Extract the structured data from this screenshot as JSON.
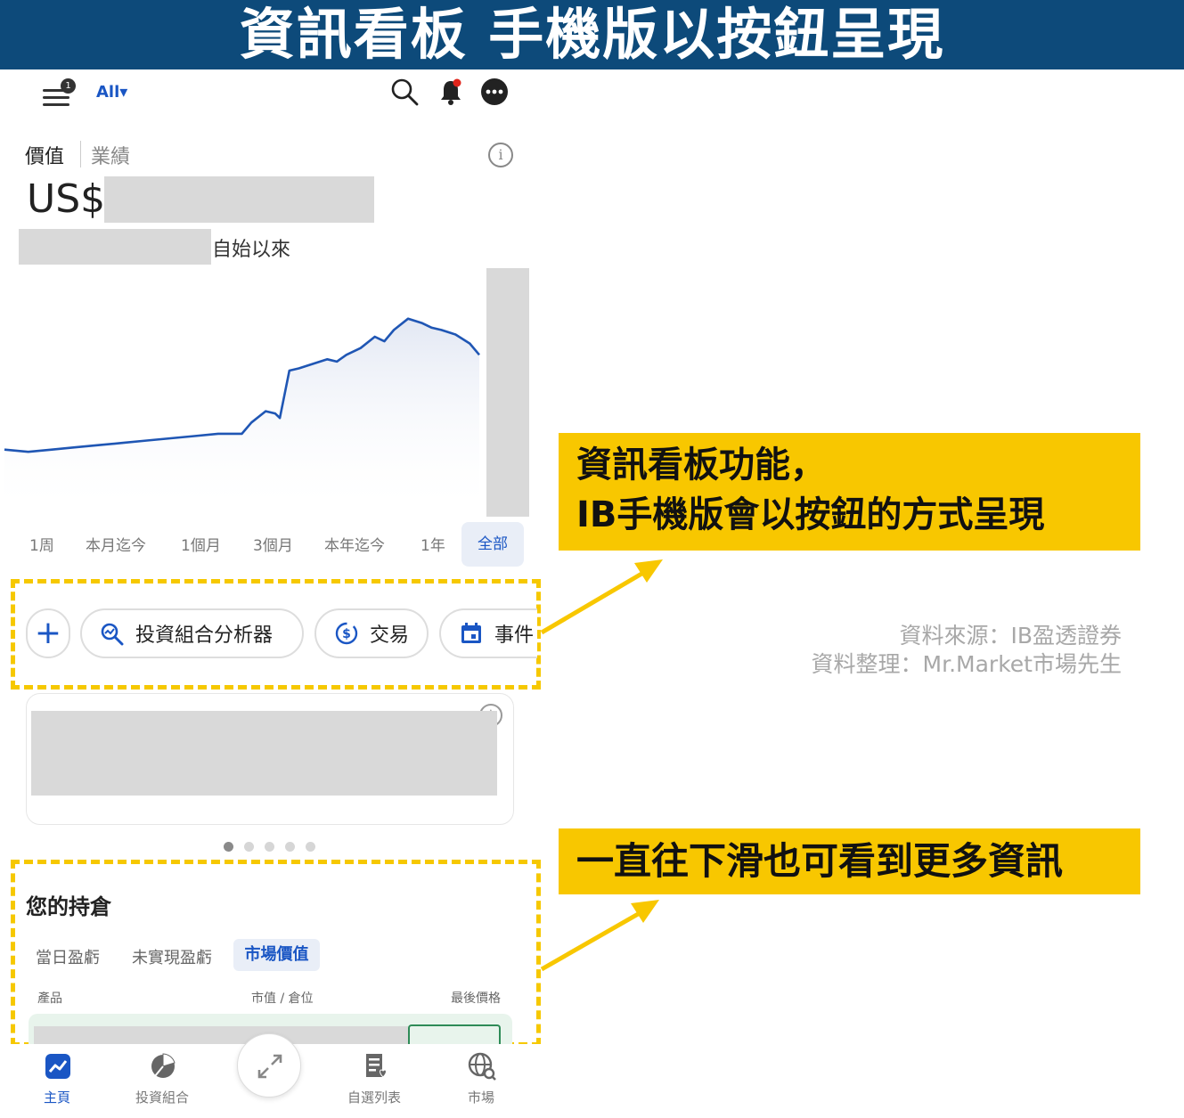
{
  "banner": {
    "title": "資訊看板 手機版以按鈕呈現"
  },
  "topbar": {
    "filter_label": "All▾",
    "icons": [
      "menu-icon",
      "search-icon",
      "bell-icon",
      "more-icon"
    ],
    "menu_badge": "1"
  },
  "portfolio": {
    "tabs": [
      "價值",
      "業績"
    ],
    "currency": "US$",
    "since_label": "自始以來",
    "info_glyph": "i"
  },
  "chart_data": {
    "type": "line",
    "x": [
      0,
      5,
      10,
      15,
      20,
      25,
      30,
      35,
      40,
      45,
      50,
      52,
      55,
      57,
      58,
      60,
      62,
      65,
      68,
      70,
      72,
      75,
      78,
      80,
      82,
      85,
      88,
      90,
      92,
      95,
      98,
      100
    ],
    "values": [
      50,
      49,
      50,
      51,
      52,
      53,
      54,
      55,
      56,
      57,
      57,
      62,
      67,
      66,
      64,
      85,
      86,
      88,
      90,
      89,
      92,
      95,
      100,
      98,
      103,
      108,
      106,
      104,
      103,
      101,
      97,
      92
    ],
    "series": [
      {
        "values": [
          50,
          49,
          50,
          51,
          52,
          53,
          54,
          55,
          56,
          57,
          57,
          62,
          67,
          66,
          64,
          85,
          86,
          88,
          90,
          89,
          92,
          95,
          100,
          98,
          103,
          108,
          106,
          104,
          103,
          101,
          97,
          92
        ],
        "color": "#1f56b4"
      }
    ],
    "title": "",
    "xlabel": "",
    "ylabel": "",
    "grid": false
  },
  "ranges": {
    "items": [
      "1周",
      "本月迄今",
      "1個月",
      "3個月",
      "本年迄今",
      "1年"
    ],
    "active": "全部"
  },
  "actions": {
    "plus_glyph": "+",
    "analyzer": "投資組合分析器",
    "trade": "交易",
    "events": "事件"
  },
  "card": {
    "info_glyph": "i"
  },
  "holdings": {
    "title": "您的持倉",
    "tabs": [
      "當日盈虧",
      "未實現盈虧"
    ],
    "active_tab": "市場價值",
    "columns": [
      "產品",
      "市值 / 倉位",
      "最後價格"
    ]
  },
  "bottom_nav": {
    "items": [
      "主頁",
      "投資組合",
      "自選列表",
      "市場"
    ]
  },
  "annotations": {
    "callout1_line1": "資訊看板功能，",
    "callout1_line2": "IB手機版會以按鈕的方式呈現",
    "callout2": "一直往下滑也可看到更多資訊",
    "source": "資料來源：IB盈透證券",
    "compiled_by": "資料整理：Mr.Market市場先生"
  },
  "colors": {
    "banner": "#0d4a7a",
    "accent": "#1a56c4",
    "highlight": "#f8c700",
    "line": "#1f56b4"
  }
}
